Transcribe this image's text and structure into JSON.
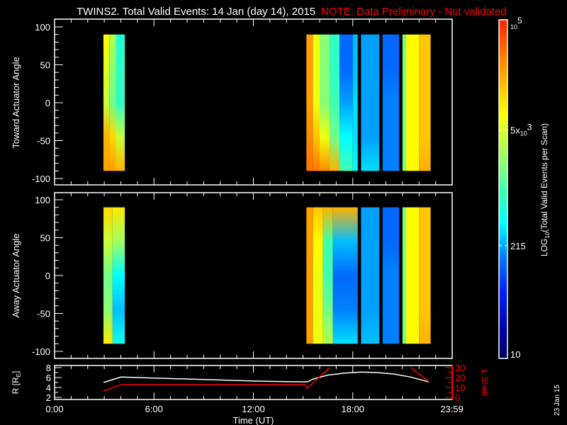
{
  "title": "TWINS2. Total Valid Events: 14 Jan (day  14), 2015",
  "note": "NOTE: Data Preliminary - Not validated",
  "footer_date": "23 Jan 15",
  "colors": {
    "background": "#000000",
    "axes": "#ffffff",
    "note": "#ff0000",
    "l_shell": "#ff0000",
    "r_line": "#ffffff"
  },
  "chart_data": [
    {
      "type": "heatmap",
      "ylabel": "Toward Actuator Angle",
      "ylim": [
        -100,
        100
      ],
      "yticks": [
        "100",
        "50",
        "0",
        "-50",
        "-100"
      ],
      "ytick_values": [
        100,
        50,
        0,
        -50,
        -100
      ],
      "xlim_hours": [
        0,
        24
      ],
      "value_scale": "log10",
      "profile_angles": [
        90,
        45,
        0,
        -45,
        -90
      ],
      "segments": [
        {
          "t": [
            2.95,
            3.3
          ],
          "log10": [
            3.9,
            3.7,
            3.6,
            4.3,
            4.4
          ]
        },
        {
          "t": [
            3.3,
            3.7
          ],
          "log10": [
            3.5,
            3.3,
            3.2,
            4.1,
            4.4
          ]
        },
        {
          "t": [
            3.7,
            4.24
          ],
          "log10": [
            2.8,
            2.9,
            2.9,
            3.6,
            4.3
          ]
        },
        {
          "t": [
            15.2,
            15.6
          ],
          "log10": [
            4.4,
            4.4,
            4.4,
            4.5,
            4.6
          ]
        },
        {
          "t": [
            15.6,
            16.0
          ],
          "log10": [
            3.8,
            3.8,
            3.8,
            4.2,
            4.6
          ]
        },
        {
          "t": [
            16.0,
            16.6
          ],
          "log10": [
            3.3,
            3.3,
            3.3,
            3.8,
            4.5
          ]
        },
        {
          "t": [
            16.6,
            17.2
          ],
          "log10": [
            2.9,
            2.9,
            3.0,
            3.2,
            4.3
          ]
        },
        {
          "t": [
            17.2,
            18.0
          ],
          "log10": [
            2.1,
            2.1,
            2.3,
            2.6,
            3.0
          ]
        },
        {
          "t": [
            18.0,
            18.3
          ],
          "log10": [
            2.4,
            2.4,
            2.5,
            2.5,
            2.6
          ]
        },
        {
          "t": [
            18.5,
            19.6
          ],
          "log10": [
            2.3,
            2.3,
            2.3,
            2.3,
            2.5
          ]
        },
        {
          "t": [
            19.8,
            20.8
          ],
          "log10": [
            2.1,
            2.1,
            2.2,
            2.2,
            2.2
          ]
        },
        {
          "t": [
            21.0,
            21.2
          ],
          "log10": [
            3.2,
            3.2,
            3.2,
            3.2,
            3.2
          ]
        },
        {
          "t": [
            21.2,
            22.0
          ],
          "log10": [
            3.9,
            3.9,
            3.9,
            3.9,
            3.9
          ]
        },
        {
          "t": [
            22.0,
            22.7
          ],
          "log10": [
            4.2,
            4.2,
            4.2,
            4.2,
            4.3
          ]
        }
      ]
    },
    {
      "type": "heatmap",
      "ylabel": "Away Actuator Angle",
      "ylim": [
        -100,
        100
      ],
      "yticks": [
        "100",
        "50",
        "0",
        "-50",
        "-100"
      ],
      "ytick_values": [
        100,
        50,
        0,
        -50,
        -100
      ],
      "xlim_hours": [
        0,
        24
      ],
      "value_scale": "log10",
      "profile_angles": [
        90,
        45,
        0,
        -45,
        -90
      ],
      "segments": [
        {
          "t": [
            2.95,
            3.5
          ],
          "log10": [
            4.1,
            3.6,
            3.2,
            3.3,
            4.0
          ]
        },
        {
          "t": [
            3.5,
            4.24
          ],
          "log10": [
            4.0,
            3.4,
            2.6,
            2.4,
            2.7
          ]
        },
        {
          "t": [
            15.2,
            15.6
          ],
          "log10": [
            4.4,
            4.4,
            4.4,
            4.4,
            4.4
          ]
        },
        {
          "t": [
            15.6,
            16.2
          ],
          "log10": [
            4.2,
            3.9,
            3.8,
            3.8,
            3.8
          ]
        },
        {
          "t": [
            16.2,
            16.8
          ],
          "log10": [
            4.3,
            3.0,
            3.0,
            3.2,
            3.5
          ]
        },
        {
          "t": [
            16.8,
            18.3
          ],
          "log10": [
            4.3,
            2.4,
            2.1,
            2.2,
            2.5
          ]
        },
        {
          "t": [
            18.5,
            19.6
          ],
          "log10": [
            2.3,
            2.3,
            2.3,
            2.3,
            2.4
          ]
        },
        {
          "t": [
            19.8,
            20.8
          ],
          "log10": [
            2.1,
            2.1,
            2.2,
            2.2,
            2.2
          ]
        },
        {
          "t": [
            21.0,
            21.2
          ],
          "log10": [
            3.2,
            3.2,
            3.2,
            3.2,
            3.2
          ]
        },
        {
          "t": [
            21.2,
            22.0
          ],
          "log10": [
            3.9,
            3.9,
            3.9,
            3.9,
            3.9
          ]
        },
        {
          "t": [
            22.0,
            22.7
          ],
          "log10": [
            4.2,
            4.2,
            4.2,
            4.2,
            4.3
          ]
        }
      ]
    },
    {
      "type": "line",
      "xlabel": "Time (UT)",
      "xticks": [
        "0:00",
        "6:00",
        "12:00",
        "18:00",
        "23:59"
      ],
      "xtick_hours": [
        0,
        6,
        12,
        18,
        23.983
      ],
      "ylabel_left": "R [RE]",
      "ylabel_left_main": "R [R",
      "ylabel_left_sub": "E",
      "ylabel_left_close": "]",
      "ylim_left": [
        2,
        8
      ],
      "yticks_left": [
        "2",
        "4",
        "6",
        "8"
      ],
      "ylabel_right": "L Shell",
      "ylim_right": [
        0,
        30
      ],
      "yticks_right": [
        "0",
        "10",
        "20",
        "30"
      ],
      "series": [
        {
          "axis": "left",
          "color": "#ffffff",
          "hours": [
            2.96,
            4.0,
            6,
            9,
            12,
            15.25,
            15.6,
            16.5,
            17.5,
            18.5,
            19.5,
            20.5,
            21.5,
            22.6
          ],
          "values": [
            5.0,
            6.1,
            5.9,
            5.6,
            5.3,
            5.1,
            5.7,
            6.5,
            6.9,
            7.1,
            7.0,
            6.7,
            6.1,
            5.1
          ]
        },
        {
          "axis": "right",
          "color": "#ff0000",
          "hours": [
            2.96,
            4.0,
            15.1,
            15.25,
            16.6
          ],
          "values": [
            6.4,
            12.9,
            12.9,
            9.3,
            30
          ]
        },
        {
          "axis": "right",
          "color": "#ff0000",
          "hours": [
            21.5,
            22.6
          ],
          "values": [
            30,
            15.7
          ]
        }
      ]
    },
    {
      "type": "colorbar",
      "label_main": "LOG",
      "label_sub": "10",
      "label_rest": "(Total Valid Events per Scan)",
      "range": [
        10,
        100000
      ],
      "ticks": [
        {
          "value": 100000,
          "label_base": "10",
          "label_exp": "5"
        },
        {
          "value": 5000,
          "label_pre": "5x",
          "label_base": "10",
          "label_exp": "3"
        },
        {
          "value": 215,
          "label": "215"
        },
        {
          "value": 10,
          "label": "10"
        }
      ],
      "colormap": "jet"
    }
  ]
}
